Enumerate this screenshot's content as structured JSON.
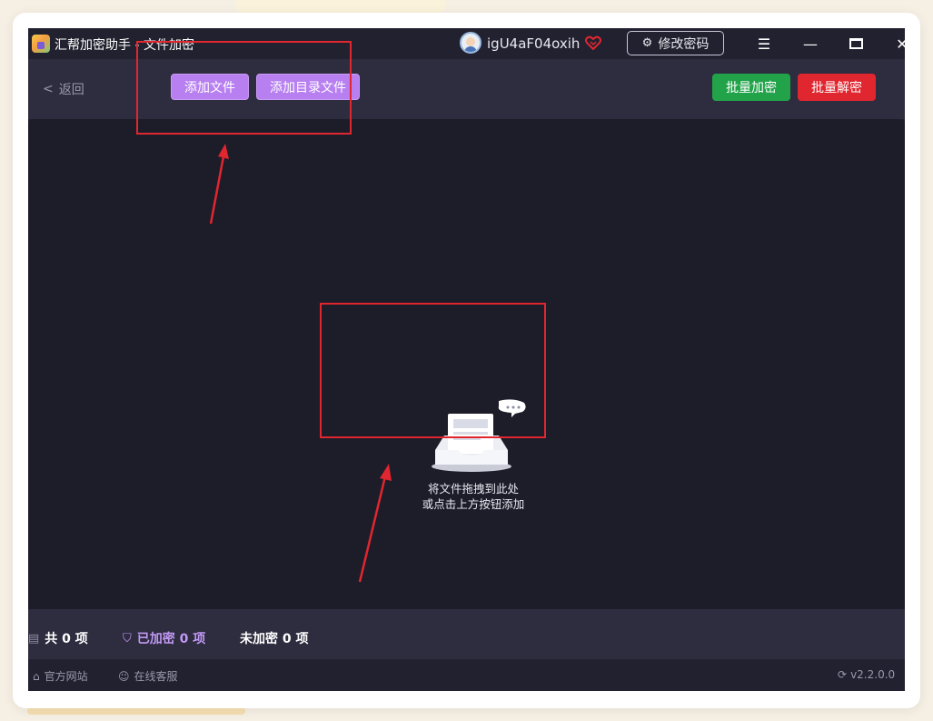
{
  "window": {
    "title": "汇帮加密助手 - 文件加密",
    "username": "igU4aF04oxih",
    "change_password_label": "修改密码",
    "menu_icon": "menu-icon",
    "minimize_icon": "minimize-icon",
    "maximize_icon": "maximize-icon",
    "close_icon": "close-icon"
  },
  "toolbar": {
    "back_label": "返回",
    "add_file_label": "添加文件",
    "add_dir_label": "添加目录文件",
    "batch_encrypt_label": "批量加密",
    "batch_decrypt_label": "批量解密"
  },
  "dropzone": {
    "line1": "将文件拖拽到此处",
    "line2": "或点击上方按钮添加"
  },
  "stats": {
    "total": "共 0 项",
    "encrypted": "已加密 0 项",
    "unencrypted": "未加密 0 项"
  },
  "footer": {
    "website_label": "官方网站",
    "service_label": "在线客服",
    "version": "v2.2.0.0"
  },
  "colors": {
    "accent_purple": "#b77ff0",
    "encrypt_green": "#22a34a",
    "decrypt_red": "#e0262f",
    "background_dark": "#1d1c29",
    "annotation_red": "#e0262f"
  }
}
